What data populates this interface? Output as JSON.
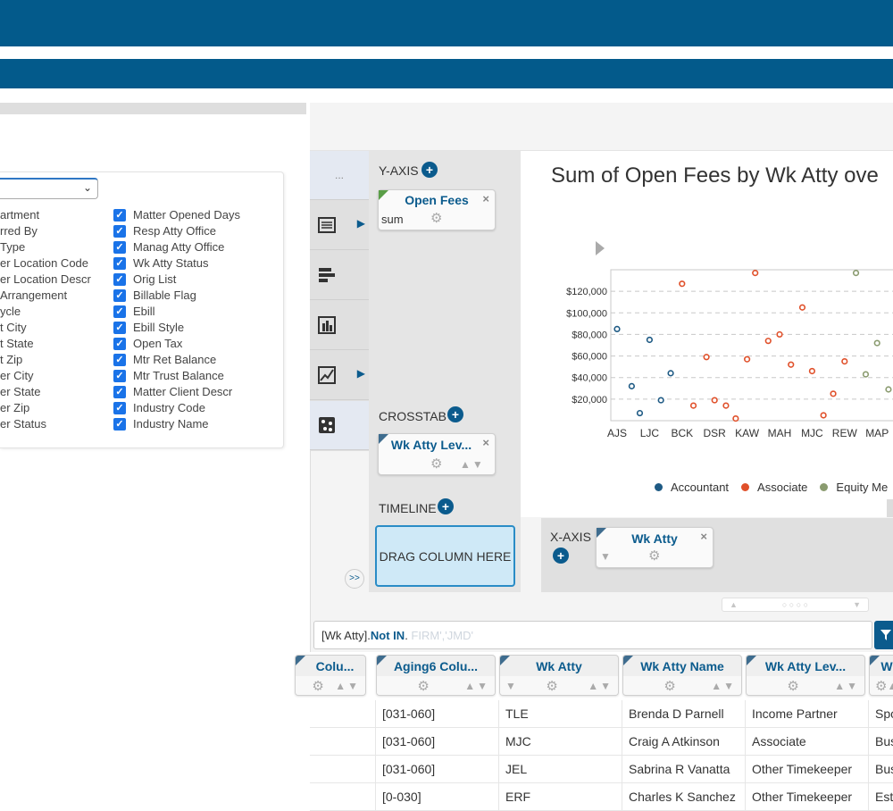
{
  "left_panel": {
    "fields_a": [
      "artment",
      "rred By",
      "Type",
      "er Location Code",
      "er Location Descr",
      "Arrangement",
      "ycle",
      "t City",
      "t State",
      "t Zip",
      "er City",
      "er State",
      "er Zip",
      "er Status"
    ],
    "fields_b": [
      "Matter Opened Days",
      "Resp Atty Office",
      "Manag Atty Office",
      "Wk Atty Status",
      "Orig List",
      "Billable Flag",
      "Ebill",
      "Ebill Style",
      "Open Tax",
      "Mtr Ret Balance",
      "Mtr Trust Balance",
      "Matter Client Descr",
      "Industry Code",
      "Industry Name"
    ]
  },
  "config": {
    "vis_tab_top": "...",
    "yaxis_label": "Y-AXIS",
    "yaxis_pill_title": "Open Fees",
    "yaxis_pill_agg": "sum",
    "crosstab_label": "CROSSTAB",
    "crosstab_pill_title": "Wk Atty Lev...",
    "timeline_label": "TIMELINE",
    "drag_text": "DRAG COLUMN HERE",
    "expand_label": ">>",
    "xaxis_label": "X-AXIS",
    "xaxis_pill_title": "Wk Atty"
  },
  "chart_data": {
    "type": "scatter",
    "title": "Sum of Open Fees by Wk Atty ove",
    "xlabel": "",
    "ylabel": "",
    "ylim": [
      0,
      140000
    ],
    "yticks": [
      "$20,000",
      "$40,000",
      "$60,000",
      "$80,000",
      "$100,000",
      "$120,000"
    ],
    "ytick_values": [
      20000,
      40000,
      60000,
      80000,
      100000,
      120000
    ],
    "categories": [
      "AJS",
      "LJC",
      "BCK",
      "DSR",
      "KAW",
      "MAH",
      "MJC",
      "REW",
      "MAP"
    ],
    "grid": true,
    "legend_position": "bottom",
    "series": [
      {
        "name": "Accountant",
        "color": "#1e5a84",
        "points": [
          [
            0,
            85000
          ],
          [
            0.45,
            32000
          ],
          [
            0.7,
            7000
          ],
          [
            1.0,
            75000
          ],
          [
            1.35,
            19000
          ],
          [
            1.65,
            44000
          ]
        ]
      },
      {
        "name": "Associate",
        "color": "#e0502a",
        "points": [
          [
            2.0,
            127000
          ],
          [
            2.35,
            14000
          ],
          [
            2.75,
            59000
          ],
          [
            3.0,
            19000
          ],
          [
            3.35,
            14000
          ],
          [
            3.65,
            2000
          ],
          [
            4.0,
            57000
          ],
          [
            4.25,
            137000
          ],
          [
            4.65,
            74000
          ],
          [
            5.0,
            80000
          ],
          [
            5.35,
            52000
          ],
          [
            5.7,
            105000
          ],
          [
            6.0,
            46000
          ],
          [
            6.35,
            5000
          ],
          [
            6.65,
            25000
          ],
          [
            7.0,
            55000
          ]
        ]
      },
      {
        "name": "Equity Me",
        "color": "#8a9b6f",
        "points": [
          [
            7.35,
            137000
          ],
          [
            7.65,
            43000
          ],
          [
            8.0,
            72000
          ],
          [
            8.35,
            29000
          ]
        ]
      }
    ]
  },
  "filter": {
    "field": "[Wk Atty].",
    "op": "Not IN",
    "dot": ".",
    "values": " FIRM','JMD'"
  },
  "grid": {
    "columns": [
      "Colu...",
      "Aging6 Colu...",
      "Wk Atty",
      "Wk Atty Name",
      "Wk Atty Lev...",
      "W"
    ],
    "rows": [
      [
        "",
        "[031-060]",
        "TLE",
        "Brenda D Parnell",
        "Income Partner",
        "Spo"
      ],
      [
        "",
        "[031-060]",
        "MJC",
        "Craig A Atkinson",
        "Associate",
        "Bus"
      ],
      [
        "",
        "[031-060]",
        "JEL",
        "Sabrina R Vanatta",
        "Other Timekeeper",
        "Bus"
      ],
      [
        "",
        "[0-030]",
        "ERF",
        "Charles K Sanchez",
        "Other Timekeeper",
        "Est"
      ]
    ]
  },
  "icons": {
    "play": "▶",
    "collapse": "◀",
    "gear": "⚙",
    "sort": "▲▼",
    "close": "×",
    "filter": "▼",
    "check": "✓",
    "plus": "+",
    "chevron_down": "⌄",
    "tab_arrow": "▶",
    "splitter_left": "▲",
    "splitter_dots": "○ ○ ○ ○",
    "splitter_right": "▼"
  },
  "colors": {
    "brand": "#035a8b",
    "accent": "#0b5b8d",
    "accountant": "#1e5a84",
    "associate": "#e0502a",
    "equity": "#8a9b6f"
  }
}
